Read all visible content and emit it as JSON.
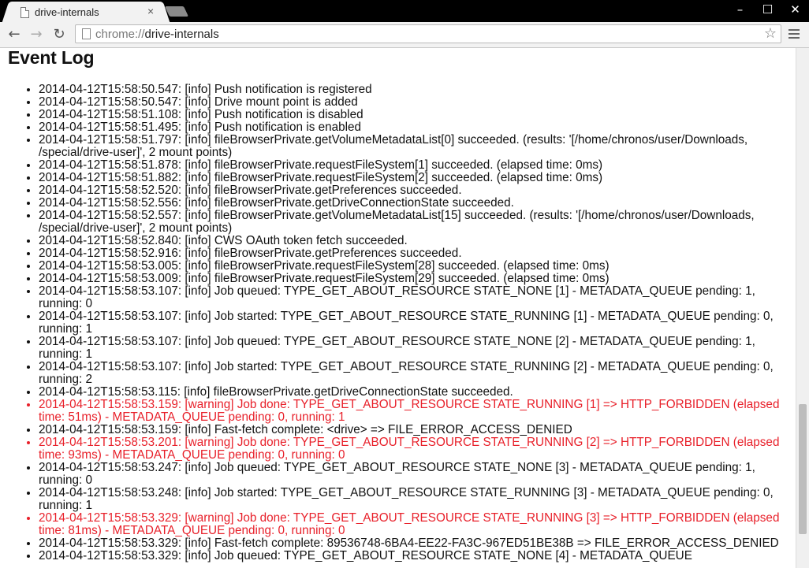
{
  "tab": {
    "title": "drive-internals",
    "close_glyph": "×"
  },
  "window_controls": {
    "minimize": "–",
    "maximize": "☐",
    "close": "✕"
  },
  "toolbar": {
    "back_glyph": "←",
    "forward_glyph": "→",
    "reload_glyph": "↻",
    "star_glyph": "☆"
  },
  "omnibox": {
    "scheme": "chrome://",
    "host": "drive-internals"
  },
  "page": {
    "section_title": "Event Log",
    "events": [
      {
        "text": "2014-04-12T15:58:50.547: [info] Push notification is registered",
        "level": "info"
      },
      {
        "text": "2014-04-12T15:58:50.547: [info] Drive mount point is added",
        "level": "info"
      },
      {
        "text": "2014-04-12T15:58:51.108: [info] Push notification is disabled",
        "level": "info"
      },
      {
        "text": "2014-04-12T15:58:51.495: [info] Push notification is enabled",
        "level": "info"
      },
      {
        "text": "2014-04-12T15:58:51.797: [info] fileBrowserPrivate.getVolumeMetadataList[0] succeeded. (results: '[/home/chronos/user/Downloads, /special/drive-user]', 2 mount points)",
        "level": "info"
      },
      {
        "text": "2014-04-12T15:58:51.878: [info] fileBrowserPrivate.requestFileSystem[1] succeeded. (elapsed time: 0ms)",
        "level": "info"
      },
      {
        "text": "2014-04-12T15:58:51.882: [info] fileBrowserPrivate.requestFileSystem[2] succeeded. (elapsed time: 0ms)",
        "level": "info"
      },
      {
        "text": "2014-04-12T15:58:52.520: [info] fileBrowserPrivate.getPreferences succeeded.",
        "level": "info"
      },
      {
        "text": "2014-04-12T15:58:52.556: [info] fileBrowserPrivate.getDriveConnectionState succeeded.",
        "level": "info"
      },
      {
        "text": "2014-04-12T15:58:52.557: [info] fileBrowserPrivate.getVolumeMetadataList[15] succeeded. (results: '[/home/chronos/user/Downloads, /special/drive-user]', 2 mount points)",
        "level": "info"
      },
      {
        "text": "2014-04-12T15:58:52.840: [info] CWS OAuth token fetch succeeded.",
        "level": "info"
      },
      {
        "text": "2014-04-12T15:58:52.916: [info] fileBrowserPrivate.getPreferences succeeded.",
        "level": "info"
      },
      {
        "text": "2014-04-12T15:58:53.005: [info] fileBrowserPrivate.requestFileSystem[28] succeeded. (elapsed time: 0ms)",
        "level": "info"
      },
      {
        "text": "2014-04-12T15:58:53.009: [info] fileBrowserPrivate.requestFileSystem[29] succeeded. (elapsed time: 0ms)",
        "level": "info"
      },
      {
        "text": "2014-04-12T15:58:53.107: [info] Job queued: TYPE_GET_ABOUT_RESOURCE STATE_NONE [1] - METADATA_QUEUE pending: 1, running: 0",
        "level": "info"
      },
      {
        "text": "2014-04-12T15:58:53.107: [info] Job started: TYPE_GET_ABOUT_RESOURCE STATE_RUNNING [1] - METADATA_QUEUE pending: 0, running: 1",
        "level": "info"
      },
      {
        "text": "2014-04-12T15:58:53.107: [info] Job queued: TYPE_GET_ABOUT_RESOURCE STATE_NONE [2] - METADATA_QUEUE pending: 1, running: 1",
        "level": "info"
      },
      {
        "text": "2014-04-12T15:58:53.107: [info] Job started: TYPE_GET_ABOUT_RESOURCE STATE_RUNNING [2] - METADATA_QUEUE pending: 0, running: 2",
        "level": "info"
      },
      {
        "text": "2014-04-12T15:58:53.115: [info] fileBrowserPrivate.getDriveConnectionState succeeded.",
        "level": "info"
      },
      {
        "text": "2014-04-12T15:58:53.159: [warning] Job done: TYPE_GET_ABOUT_RESOURCE STATE_RUNNING [1] => HTTP_FORBIDDEN (elapsed time: 51ms) - METADATA_QUEUE pending: 0, running: 1",
        "level": "warning"
      },
      {
        "text": "2014-04-12T15:58:53.159: [info] Fast-fetch complete: <drive> => FILE_ERROR_ACCESS_DENIED",
        "level": "info"
      },
      {
        "text": "2014-04-12T15:58:53.201: [warning] Job done: TYPE_GET_ABOUT_RESOURCE STATE_RUNNING [2] => HTTP_FORBIDDEN (elapsed time: 93ms) - METADATA_QUEUE pending: 0, running: 0",
        "level": "warning"
      },
      {
        "text": "2014-04-12T15:58:53.247: [info] Job queued: TYPE_GET_ABOUT_RESOURCE STATE_NONE [3] - METADATA_QUEUE pending: 1, running: 0",
        "level": "info"
      },
      {
        "text": "2014-04-12T15:58:53.248: [info] Job started: TYPE_GET_ABOUT_RESOURCE STATE_RUNNING [3] - METADATA_QUEUE pending: 0, running: 1",
        "level": "info"
      },
      {
        "text": "2014-04-12T15:58:53.329: [warning] Job done: TYPE_GET_ABOUT_RESOURCE STATE_RUNNING [3] => HTTP_FORBIDDEN (elapsed time: 81ms) - METADATA_QUEUE pending: 0, running: 0",
        "level": "warning"
      },
      {
        "text": "2014-04-12T15:58:53.329: [info] Fast-fetch complete: 89536748-6BA4-EE22-FA3C-967ED51BE38B => FILE_ERROR_ACCESS_DENIED",
        "level": "info"
      },
      {
        "text": "2014-04-12T15:58:53.329: [info] Job queued: TYPE_GET_ABOUT_RESOURCE STATE_NONE [4] - METADATA_QUEUE",
        "level": "info"
      }
    ]
  }
}
